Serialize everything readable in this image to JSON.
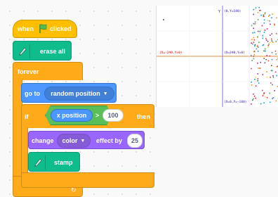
{
  "scripts": {
    "when_flag": {
      "prefix": "when",
      "suffix": "clicked"
    },
    "erase_all": {
      "label": "erase all"
    },
    "forever": {
      "label": "forever"
    },
    "go_to": {
      "prefix": "go to",
      "target": "random position"
    },
    "if_block": {
      "if_label": "if",
      "then_label": "then",
      "left_reporter": "x position",
      "operator": ">",
      "right_value": "100"
    },
    "change_effect": {
      "prefix": "change",
      "effect": "color",
      "middle": "effect by",
      "amount": "25"
    },
    "stamp": {
      "label": "stamp"
    }
  },
  "stage": {
    "y_axis_label": "Y",
    "top_label": "(0,Y=180)",
    "left_label": "(X=-240,Y=0)",
    "right_label": "(X=240,Y=0)",
    "bottom_label": "(X=0,Y=-180)"
  },
  "colors": {
    "events": "#ffbf00",
    "pen": "#0fbd8c",
    "control": "#ffab19",
    "motion": "#4c97ff",
    "operators": "#59c059",
    "looks": "#9966ff"
  },
  "icons": [
    "green-flag-icon",
    "pen-icon",
    "dropdown-arrow-icon",
    "loop-arrow-icon"
  ]
}
